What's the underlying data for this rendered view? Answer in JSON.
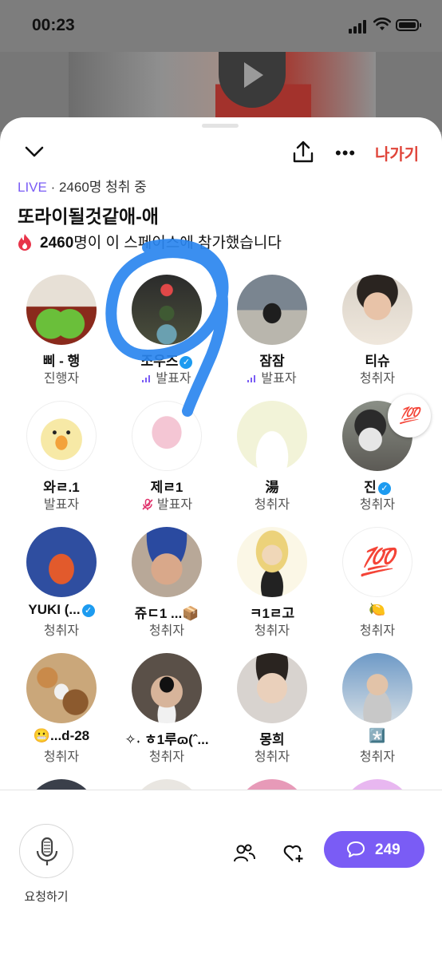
{
  "status": {
    "time": "00:23"
  },
  "header": {
    "leave_label": "나가기"
  },
  "live": {
    "badge": "LIVE",
    "listening": "· 2460명 청취 중"
  },
  "space": {
    "title": "또라이될것같애-애",
    "joined_count": "2460",
    "joined_text": "명이 이 스페이스에 참가했습니다"
  },
  "participants": [
    {
      "name": "삐 - 행",
      "role": "진행자"
    },
    {
      "name": "조우즈",
      "role": "발표자"
    },
    {
      "name": "잠잠",
      "role": "발표자"
    },
    {
      "name": "티슈",
      "role": "청취자"
    },
    {
      "name": "와ㄹ.1",
      "role": "발표자"
    },
    {
      "name": "제ㄹ1",
      "role": "발표자"
    },
    {
      "name": "湯",
      "role": "청취자"
    },
    {
      "name": "진",
      "role": "청취자"
    },
    {
      "name": "YUKI (...",
      "role": "청취자"
    },
    {
      "name": "쥬ㄷ1 ...📦",
      "role": "청취자"
    },
    {
      "name": "ㅋ1ㄹ고",
      "role": "청취자"
    },
    {
      "name": "🍋",
      "role": "청취자"
    },
    {
      "name": "😬...d-28",
      "role": "청취자"
    },
    {
      "name": "✧˖ ㅎ1루ɷ(ˆ...",
      "role": "청취자"
    },
    {
      "name": "몽희",
      "role": "청취자"
    },
    {
      "name": "*️⃣",
      "role": "청취자"
    }
  ],
  "badges": {
    "hundred": "💯"
  },
  "footer": {
    "request_label": "요청하기",
    "comment_count": "249"
  },
  "colors": {
    "accent": "#7a5cf5",
    "leave": "#e0453a",
    "verified": "#1d9bf0"
  }
}
